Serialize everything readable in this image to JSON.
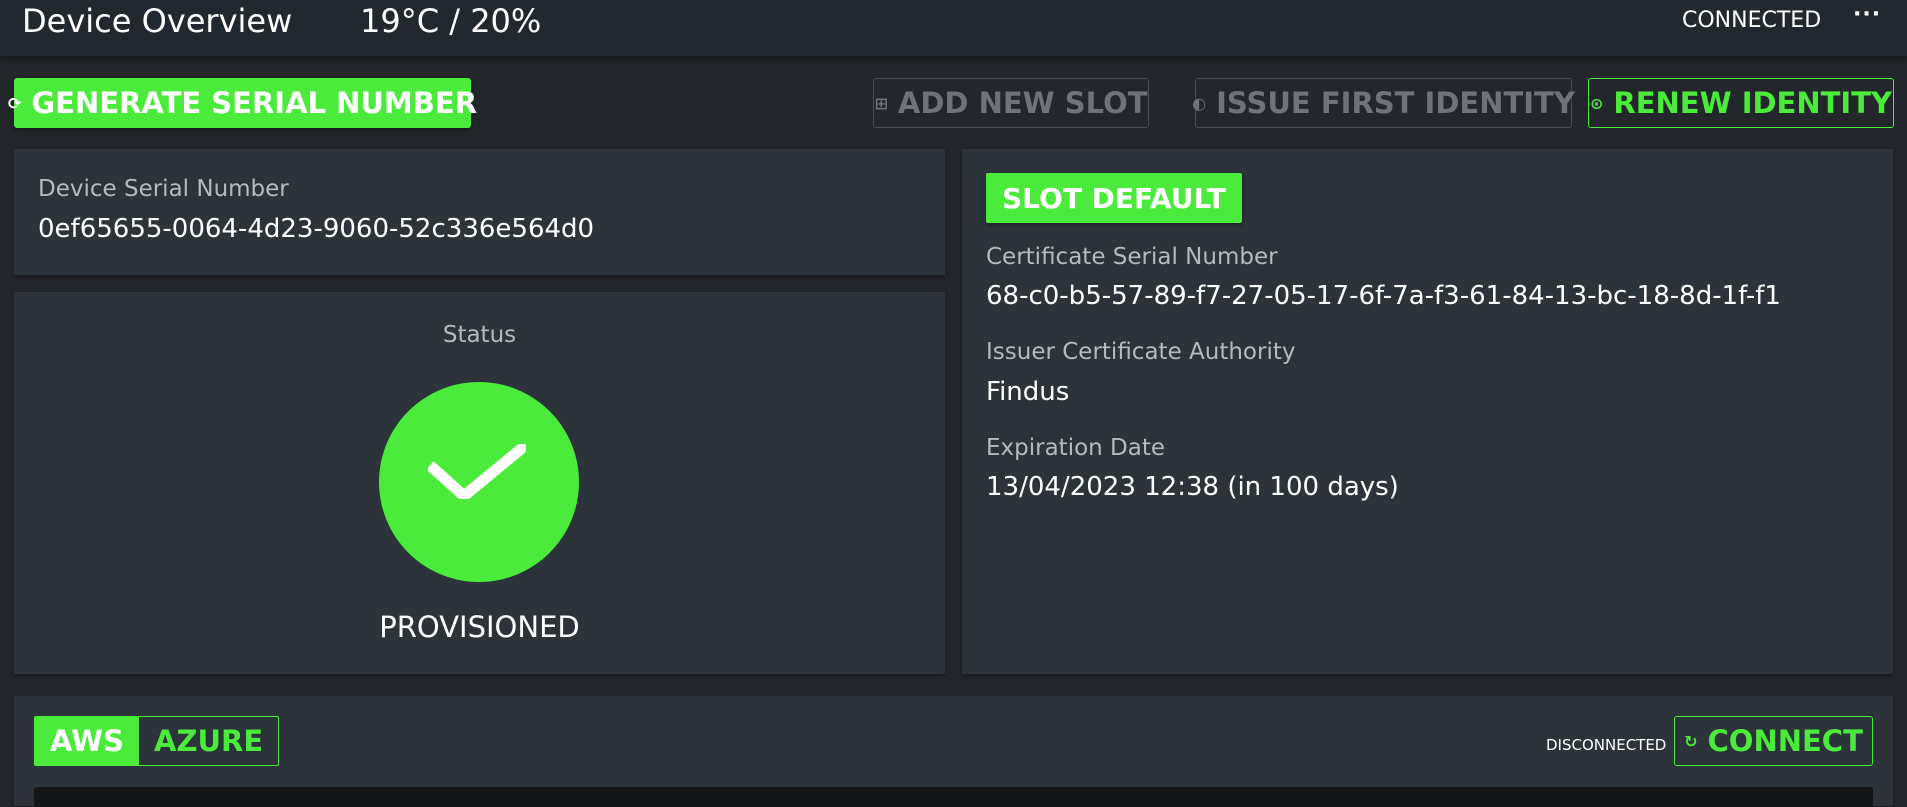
{
  "header": {
    "title": "Device Overview",
    "environment": "19°C  /  20%",
    "connection_status": "CONNECTED",
    "menu_icon": "more-horizontal-icon"
  },
  "toolbar": {
    "generate_serial_label": "GENERATE SERIAL NUMBER",
    "add_slot_label": "ADD NEW SLOT",
    "issue_identity_label": "ISSUE FIRST IDENTITY",
    "renew_identity_label": "RENEW IDENTITY"
  },
  "device": {
    "serial_label": "Device Serial Number",
    "serial_value": "0ef65655-0064-4d23-9060-52c336e564d0"
  },
  "status": {
    "label": "Status",
    "value": "PROVISIONED",
    "icon": "check-icon"
  },
  "slot": {
    "badge": "SLOT DEFAULT",
    "cert_serial_label": "Certificate Serial Number",
    "cert_serial_value": "68-c0-b5-57-89-f7-27-05-17-6f-7a-f3-61-84-13-bc-18-8d-1f-f1",
    "issuer_label": "Issuer Certificate Authority",
    "issuer_value": "Findus",
    "expiration_label": "Expiration Date",
    "expiration_value": "13/04/2023 12:38 (in 100 days)"
  },
  "cloud": {
    "tabs": [
      {
        "label": "AWS",
        "active": true
      },
      {
        "label": "AZURE",
        "active": false
      }
    ],
    "connection_status": "DISCONNECTED",
    "connect_label": "CONNECT"
  },
  "colors": {
    "accent": "#4aeb3a",
    "background": "#23262b",
    "card": "#2c333b",
    "topbar": "#212830"
  }
}
